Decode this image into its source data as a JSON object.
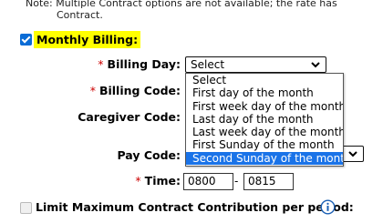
{
  "note": {
    "line1": "Note: Multiple Contract options are not available; the rate has",
    "line2": "Contract."
  },
  "monthly_billing": {
    "label": "Monthly Billing:",
    "checked": true
  },
  "billing_day": {
    "label": "Billing Day:",
    "selected": "Select",
    "options": [
      "Select",
      "First day of the month",
      "First week day of the month",
      "Last day of the month",
      "Last week day of the month",
      "First Sunday of the month",
      "Second Sunday of the month"
    ],
    "highlighted": "Second Sunday of the month"
  },
  "billing_code": {
    "label": "Billing Code:"
  },
  "caregiver_code": {
    "label": "Caregiver Code:"
  },
  "pay_code": {
    "label": "Pay Code:"
  },
  "time": {
    "label": "Time:",
    "from": "0800",
    "separator": "-",
    "to": "0815"
  },
  "limit": {
    "label": "Limit Maximum Contract Contribution per period:",
    "checked": false
  },
  "required_marker": "*",
  "colors": {
    "highlight": "#ffff00",
    "selected_option": "#1a73e8",
    "required": "#cc0000",
    "checkbox": "#0a6cd6",
    "info": "#1a5fb4"
  },
  "icons": {
    "dropdown": "chevron-down-icon",
    "info": "info-icon",
    "checkbox": "checkmark-icon"
  }
}
